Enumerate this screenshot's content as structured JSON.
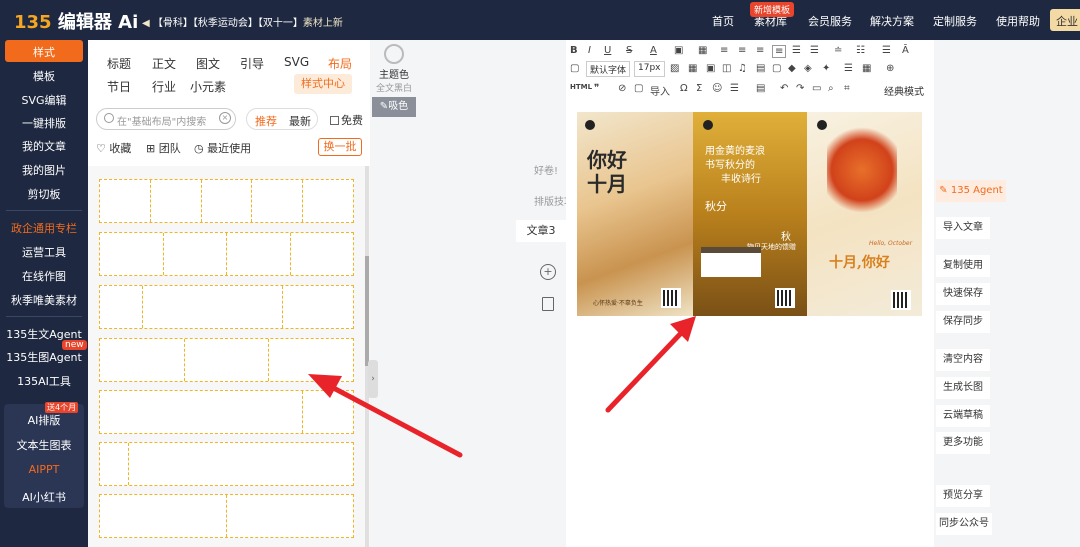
{
  "topbar": {
    "logo_num": "135",
    "logo_text": "编辑器",
    "logo_ai": "Ai",
    "ticker_prefix": "【骨科】【秋季运动会】【双十一】",
    "ticker_suffix": "素材上新",
    "nav": [
      "首页",
      "素材库",
      "会员服务",
      "解决方案",
      "定制服务",
      "使用帮助"
    ],
    "new_badge": "新增模板",
    "enterprise": "企业"
  },
  "sidebar": {
    "items": [
      "样式",
      "模板",
      "SVG编辑",
      "一键排版",
      "我的文章",
      "我的图片",
      "剪切板",
      "政企通用专栏",
      "运营工具",
      "在线作图",
      "秋季唯美素材",
      "135生文Agent",
      "135生图Agent",
      "135AI工具",
      "AI排版",
      "文本生图表",
      "AIPPT",
      "AI小红书"
    ],
    "new_tag": "new",
    "free_tag": "送4个月"
  },
  "panel": {
    "cats_row1": [
      "标题",
      "正文",
      "图文",
      "引导",
      "SVG",
      "布局"
    ],
    "cats_row2": [
      "节日",
      "行业",
      "小元素"
    ],
    "style_center": "样式中心",
    "search_placeholder": "在\"基础布局\"内搜索",
    "tab_recommend": "推荐",
    "tab_newest": "最新",
    "free": "免费",
    "favorite": "收藏",
    "team": "团队",
    "recent": "最近使用",
    "swap": "换一批"
  },
  "theme": {
    "label": "主题色",
    "full": "全文黑白",
    "pick": "吸色"
  },
  "editor": {
    "font_default": "默认字体",
    "font_size": "17px",
    "html_label": "HTML",
    "import": "导入",
    "classic_mode": "经典模式"
  },
  "poster": {
    "p1_title": "你好十月",
    "p1_foot": "心怀热爱·不辜负生",
    "p2_line1": "用金黄的麦浪",
    "p2_line2": "书写秋分的",
    "p2_line3": "丰收诗行",
    "p2_autumn": "秋分",
    "p2_autumn2": "秋",
    "p2_sub": "物见天地的馈赠",
    "p3_title": "十月,你好",
    "p3_en": "Hello, October"
  },
  "mid": {
    "hint1": "好卷!",
    "hint2": "排版技巧",
    "article_tab": "文章3"
  },
  "right": {
    "agent": "135 Agent",
    "buttons": [
      "导入文章",
      "复制使用",
      "快速保存",
      "保存同步",
      "清空内容",
      "生成长图",
      "云端草稿",
      "更多功能",
      "预览分享",
      "同步公众号"
    ]
  }
}
